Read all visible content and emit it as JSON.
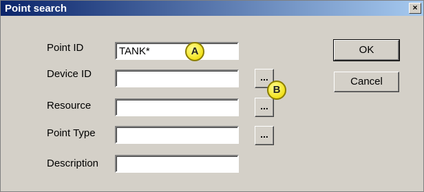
{
  "window": {
    "title": "Point search",
    "close_glyph": "×"
  },
  "fields": [
    {
      "label": "Point ID",
      "value": "TANK*"
    },
    {
      "label": "Device ID",
      "value": ""
    },
    {
      "label": "Resource",
      "value": ""
    },
    {
      "label": "Point Type",
      "value": ""
    },
    {
      "label": "Description",
      "value": ""
    }
  ],
  "browse_label": "...",
  "buttons": {
    "ok": "OK",
    "cancel": "Cancel"
  },
  "callouts": {
    "a": "A",
    "b": "B"
  },
  "colors": {
    "titlebar_start": "#0a246a",
    "titlebar_end": "#a6caf0",
    "face": "#d4d0c8",
    "callout": "#f2e11a"
  }
}
